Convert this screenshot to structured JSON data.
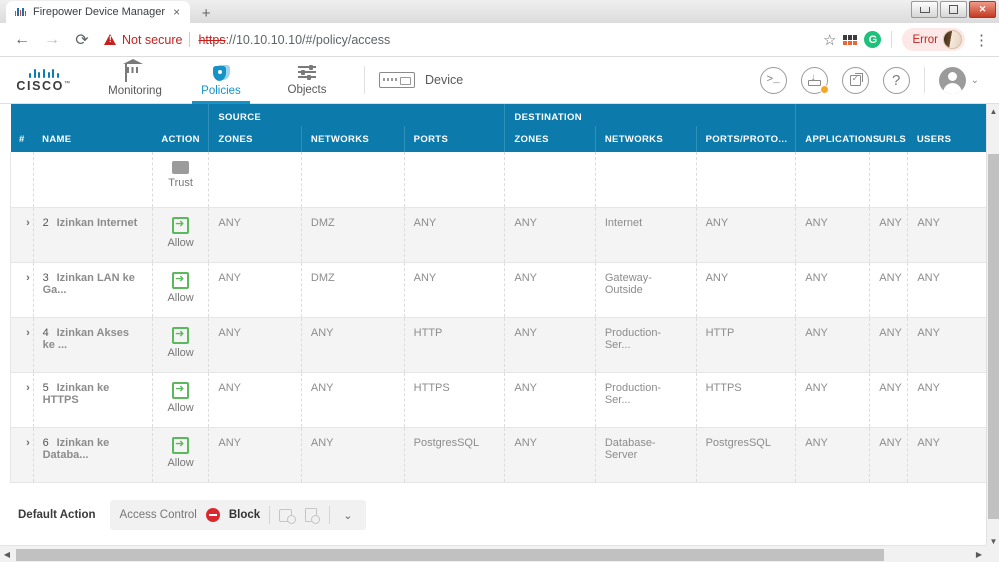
{
  "browser": {
    "tab_title": "Firepower Device Manager",
    "tab_close": "×",
    "new_tab": "+",
    "back": "←",
    "forward": "→",
    "reload": "⟳",
    "security_label": "Not secure",
    "url_scheme": "https",
    "url_rest": "://10.10.10.10/#/policy/access",
    "star": "☆",
    "g_icon_label": "G",
    "error_label": "Error",
    "kebab": "⋮",
    "window": {
      "minimize": "",
      "maximize": "",
      "close": "✕"
    }
  },
  "appnav": {
    "brand": "CISCO",
    "brand_tm": "™",
    "items": [
      {
        "label": "Monitoring",
        "icon": "monitoring-icon",
        "active": false
      },
      {
        "label": "Policies",
        "icon": "policies-shield-icon",
        "active": true
      },
      {
        "label": "Objects",
        "icon": "objects-sliders-icon",
        "active": false
      }
    ],
    "device": {
      "label": "Device",
      "icon": "device-rack-icon"
    },
    "right_icons": [
      {
        "name": "cli-console-icon",
        "glyph": ">_"
      },
      {
        "name": "deploy-icon",
        "glyph": ""
      },
      {
        "name": "tasks-icon",
        "glyph": ""
      },
      {
        "name": "help-icon",
        "glyph": "?"
      }
    ],
    "user_chevron": "⌄"
  },
  "table": {
    "group_headers": {
      "source": "SOURCE",
      "destination": "DESTINATION"
    },
    "columns": {
      "num": "#",
      "name": "NAME",
      "action": "ACTION",
      "src_zones": "ZONES",
      "src_networks": "NETWORKS",
      "src_ports": "PORTS",
      "dst_zones": "ZONES",
      "dst_networks": "NETWORKS",
      "dst_ports": "PORTS/PROTO...",
      "applications": "APPLICATIONS",
      "urls": "URLS",
      "users": "USERS"
    },
    "partial_row": {
      "action": "Trust"
    },
    "rows": [
      {
        "toggle": "›",
        "num": "2",
        "name": "Izinkan Internet",
        "action": "Allow",
        "src_zones": "ANY",
        "src_networks": "DMZ",
        "src_ports": "ANY",
        "dst_zones": "ANY",
        "dst_networks": "Internet",
        "dst_ports": "ANY",
        "applications": "ANY",
        "urls": "ANY",
        "users": "ANY"
      },
      {
        "toggle": "›",
        "num": "3",
        "name": "Izinkan LAN ke Ga...",
        "action": "Allow",
        "src_zones": "ANY",
        "src_networks": "DMZ",
        "src_ports": "ANY",
        "dst_zones": "ANY",
        "dst_networks": "Gateway-Outside",
        "dst_ports": "ANY",
        "applications": "ANY",
        "urls": "ANY",
        "users": "ANY"
      },
      {
        "toggle": "›",
        "num": "4",
        "name": "Izinkan Akses ke ...",
        "action": "Allow",
        "src_zones": "ANY",
        "src_networks": "ANY",
        "src_ports": "HTTP",
        "dst_zones": "ANY",
        "dst_networks": "Production-Ser...",
        "dst_ports": "HTTP",
        "applications": "ANY",
        "urls": "ANY",
        "users": "ANY"
      },
      {
        "toggle": "›",
        "num": "5",
        "name": "Izinkan ke HTTPS",
        "action": "Allow",
        "src_zones": "ANY",
        "src_networks": "ANY",
        "src_ports": "HTTPS",
        "dst_zones": "ANY",
        "dst_networks": "Production-Ser...",
        "dst_ports": "HTTPS",
        "applications": "ANY",
        "urls": "ANY",
        "users": "ANY"
      },
      {
        "toggle": "›",
        "num": "6",
        "name": "Izinkan ke Databa...",
        "action": "Allow",
        "src_zones": "ANY",
        "src_networks": "ANY",
        "src_ports": "PostgresSQL",
        "dst_zones": "ANY",
        "dst_networks": "Database-Server",
        "dst_ports": "PostgresSQL",
        "applications": "ANY",
        "urls": "ANY",
        "users": "ANY"
      }
    ]
  },
  "default_action": {
    "label": "Default Action",
    "access_control": "Access Control",
    "block": "Block",
    "chevron": "⌄"
  },
  "scrollbars": {
    "up": "▲",
    "down": "▼",
    "left": "◀",
    "right": "▶"
  },
  "colors": {
    "header_blue": "#0c7aaa",
    "accent": "#1593c8",
    "allow_green": "#5cb85c",
    "block_red": "#d9282f",
    "warn_red": "#c5221f",
    "deploy_badge": "#f5a623"
  }
}
